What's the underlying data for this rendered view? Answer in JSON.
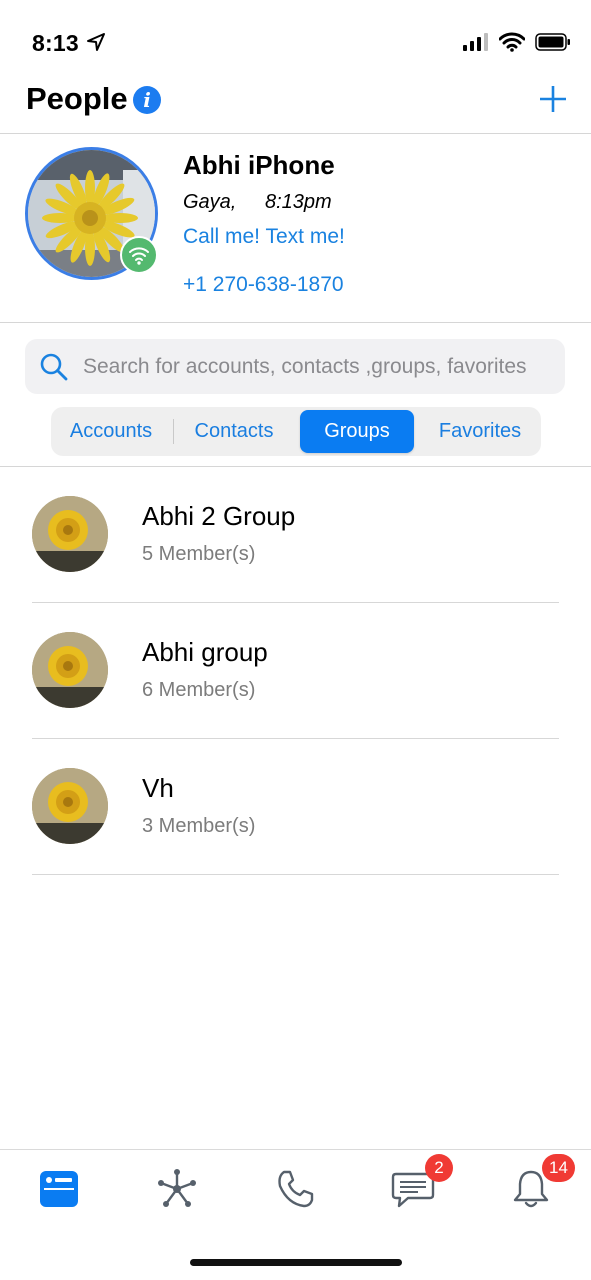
{
  "status_bar": {
    "time": "8:13"
  },
  "header": {
    "title": "People"
  },
  "profile": {
    "name": "Abhi iPhone",
    "location": "Gaya,",
    "time": "8:13pm",
    "status": "Call me! Text me!",
    "phone": "+1 270-638-1870"
  },
  "search": {
    "placeholder": "Search for accounts, contacts ,groups, favorites"
  },
  "tabs": [
    {
      "label": "Accounts"
    },
    {
      "label": "Contacts"
    },
    {
      "label": "Groups"
    },
    {
      "label": "Favorites"
    }
  ],
  "groups": [
    {
      "name": "Abhi 2 Group",
      "members": "5 Member(s)"
    },
    {
      "name": "Abhi group",
      "members": "6 Member(s)"
    },
    {
      "name": "Vh",
      "members": "3 Member(s)"
    }
  ],
  "tab_bar": {
    "messages_badge": "2",
    "notifications_badge": "14"
  },
  "colors": {
    "accent": "#0a7cf2",
    "online": "#54b96f",
    "badge": "#f03a34"
  }
}
